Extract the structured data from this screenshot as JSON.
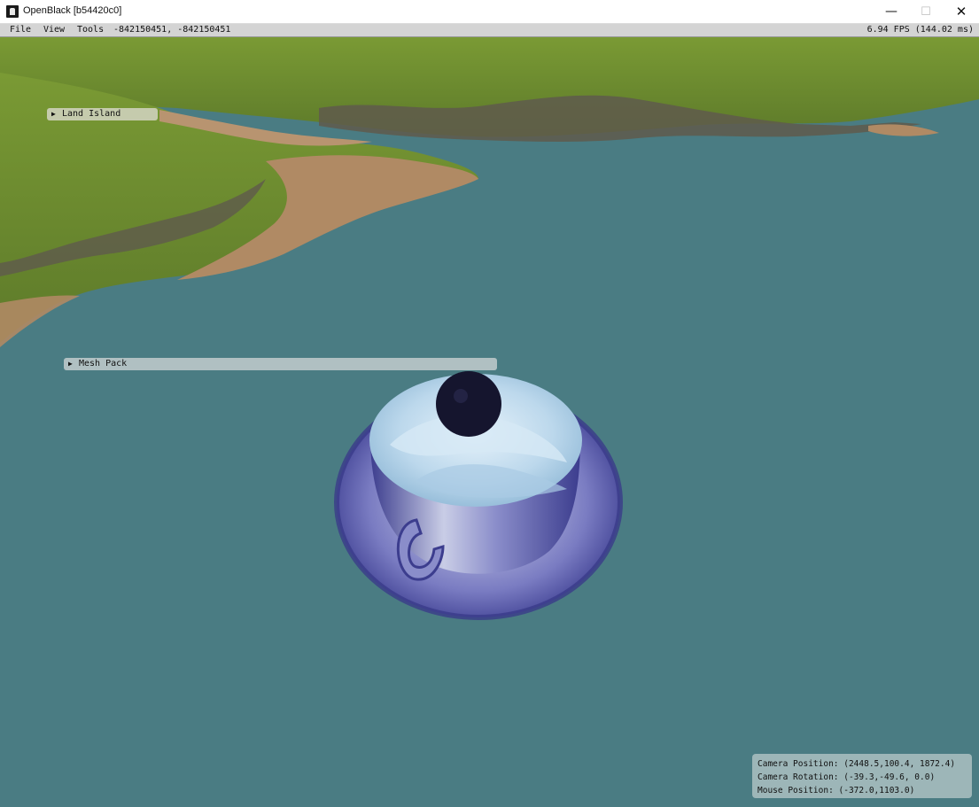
{
  "window": {
    "title": "OpenBlack [b54420c0]",
    "minimize_glyph": "—",
    "maximize_glyph": "☐",
    "close_glyph": "✕"
  },
  "menubar": {
    "file": "File",
    "view": "View",
    "tools": "Tools",
    "coords": "-842150451, -842150451",
    "fps": "6.94 FPS (144.02 ms)"
  },
  "panels": {
    "land_island": "Land Island",
    "mesh_pack": "Mesh Pack",
    "collapsed_arrow": "▶"
  },
  "camera": {
    "position": "Camera Position: (2448.5,100.4, 1872.4)",
    "rotation": "Camera Rotation: (-39.3,-49.6, 0.0)",
    "mouse": "Mouse Position: (-372.0,1103.0)"
  },
  "scene": {
    "water_color": "#4a7c83",
    "grass_color": "#6f8f2e",
    "sand_color": "#b08a64",
    "rock_color": "#5f5a4c",
    "cup_blue": "#4a4aa0",
    "cream_color": "#bcd8ec",
    "berry_color": "#15152e"
  },
  "icons": {
    "app": "openblack-icon",
    "arrow": "collapse-arrow-icon"
  }
}
